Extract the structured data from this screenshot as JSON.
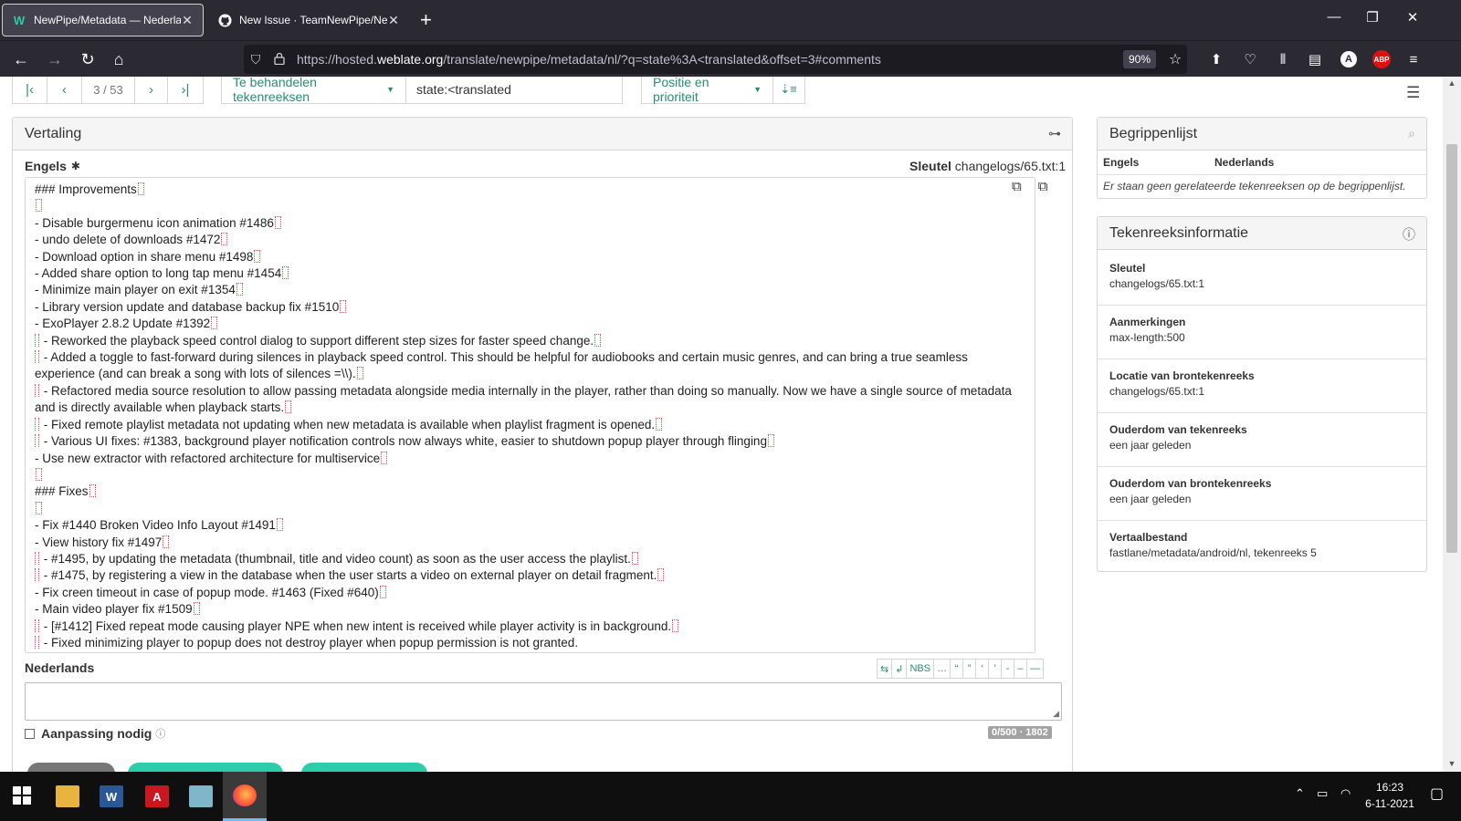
{
  "browser": {
    "tabs": [
      {
        "title": "NewPipe/Metadata — Nederlan",
        "favicon": "weblate-icon",
        "active": true
      },
      {
        "title": "New Issue · TeamNewPipe/New",
        "favicon": "github-icon",
        "active": false
      }
    ],
    "url": {
      "prefix": "https://hosted.",
      "domain": "weblate.org",
      "path": "/translate/newpipe/metadata/nl/?q=state%3A<translated&offset=3#comments"
    },
    "zoom": "90%",
    "new_tab": "+"
  },
  "toolbar": {
    "position": "3 / 53",
    "filter_label": "Te behandelen tekenreeksen",
    "query": "state:<translated",
    "sort_label": "Positie en prioriteit"
  },
  "translation_panel": {
    "title": "Vertaling",
    "source_language": "Engels",
    "key_label": "Sleutel",
    "key_value": "changelogs/65.txt:1",
    "source_lines": [
      {
        "text": "### Improvements",
        "ws": true,
        "lead": false
      },
      {
        "text": "",
        "ws": true,
        "lead": false
      },
      {
        "text": "- Disable burgermenu icon animation #1486",
        "ws": true,
        "lead": false
      },
      {
        "text": "- undo delete of downloads #1472",
        "ws": true,
        "lead": false
      },
      {
        "text": "- Download option in share menu #1498",
        "ws": true,
        "lead": false
      },
      {
        "text": "- Added share option to long tap menu #1454",
        "ws": true,
        "lead": false
      },
      {
        "text": "- Minimize main player on exit #1354",
        "ws": true,
        "lead": false
      },
      {
        "text": "- Library version update and database backup fix #1510",
        "ws": true,
        "lead": false
      },
      {
        "text": "- ExoPlayer 2.8.2 Update #1392",
        "ws": true,
        "lead": false
      },
      {
        "text": " - Reworked the playback speed control dialog to support different step sizes for faster speed change.",
        "ws": true,
        "lead": true
      },
      {
        "text": " - Added a toggle to fast-forward during silences in playback speed control. This should be helpful for audiobooks and certain music genres, and can bring a true seamless experience (and can break a song with lots of silences =\\\\).",
        "ws": true,
        "lead": true
      },
      {
        "text": " - Refactored media source resolution to allow passing metadata alongside media internally in the player, rather than doing so manually. Now we have a single source of metadata and is directly available when playback starts.",
        "ws": true,
        "lead": true
      },
      {
        "text": " - Fixed remote playlist metadata not updating when new metadata is available when playlist fragment is opened.",
        "ws": true,
        "lead": true
      },
      {
        "text": " - Various UI fixes: #1383, background player notification controls now always white, easier to shutdown popup player through flinging",
        "ws": true,
        "lead": true
      },
      {
        "text": "- Use new extractor with refactored architecture for multiservice",
        "ws": true,
        "lead": false
      },
      {
        "text": "",
        "ws": true,
        "lead": false
      },
      {
        "text": "### Fixes",
        "ws": true,
        "lead": false
      },
      {
        "text": "",
        "ws": true,
        "lead": false
      },
      {
        "text": "- Fix #1440 Broken Video Info Layout #1491",
        "ws": true,
        "lead": false
      },
      {
        "text": "- View history fix #1497",
        "ws": true,
        "lead": false
      },
      {
        "text": " - #1495, by updating the metadata (thumbnail, title and video count) as soon as the user access the playlist.",
        "ws": true,
        "lead": true
      },
      {
        "text": " - #1475, by registering a view in the database when the user starts a video on external player on detail fragment.",
        "ws": true,
        "lead": true
      },
      {
        "text": "- Fix creen timeout in case of popup mode. #1463 (Fixed #640)",
        "ws": true,
        "lead": false
      },
      {
        "text": "- Main video player fix #1509",
        "ws": true,
        "lead": false
      },
      {
        "text": " - [#1412] Fixed repeat mode causing player NPE when new intent is received while player activity is in background.",
        "ws": true,
        "lead": true
      },
      {
        "text": " - Fixed minimizing player to popup does not destroy player when popup permission is not granted.",
        "ws": false,
        "lead": true
      }
    ],
    "target_language": "Nederlands",
    "char_tools": [
      "⇆",
      "↲",
      "NBS",
      "…",
      "“",
      "”",
      "‘",
      "’",
      "-",
      "–",
      "—"
    ],
    "needs_editing_label": "Aanpassing nodig",
    "counter": "0/500 · 1802"
  },
  "glossary": {
    "title": "Begrippenlijst",
    "col_source": "Engels",
    "col_target": "Nederlands",
    "empty_note": "Er staan geen gerelateerde tekenreeksen op de begrippenlijst."
  },
  "string_info": {
    "title": "Tekenreeksinformatie",
    "items": [
      {
        "label": "Sleutel",
        "value": "changelogs/65.txt:1"
      },
      {
        "label": "Aanmerkingen",
        "value": "max-length:500"
      },
      {
        "label": "Locatie van brontekenreeks",
        "value": "changelogs/65.txt:1"
      },
      {
        "label": "Ouderdom van tekenreeks",
        "value": "een jaar geleden"
      },
      {
        "label": "Ouderdom van brontekenreeks",
        "value": "een jaar geleden"
      },
      {
        "label": "Vertaalbestand",
        "value": "fastlane/metadata/android/nl, tekenreeks 5"
      }
    ]
  },
  "taskbar": {
    "time": "16:23",
    "date": "6-11-2021",
    "apps": [
      "file-explorer-icon",
      "word-icon",
      "acrobat-icon",
      "notepad-icon",
      "firefox-icon"
    ]
  },
  "colors": {
    "accent": "#2a8d72",
    "chrome": "#2b2a33",
    "taskbar": "#0f0f10"
  }
}
